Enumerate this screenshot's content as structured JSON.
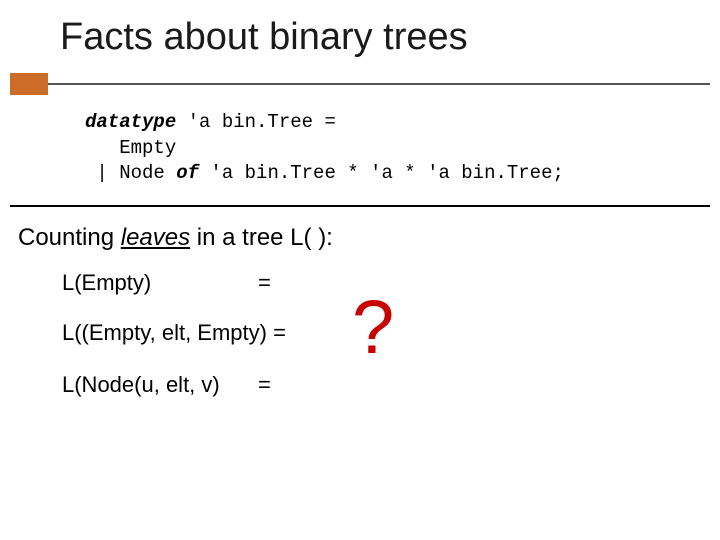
{
  "title": "Facts about binary trees",
  "code": {
    "kw_datatype": "datatype",
    "line1_rest": " 'a bin.Tree =",
    "line2": "   Empty",
    "line3_pre": " | Node ",
    "kw_of": "of",
    "line3_rest": " 'a bin.Tree * 'a * 'a bin.Tree;"
  },
  "subtitle": {
    "pre": "Counting ",
    "emph": "leaves",
    "post": " in a tree L( ):"
  },
  "rows": {
    "r1_lhs": "L(Empty)",
    "r1_eq": "=",
    "r2_full": "L((Empty, elt, Empty) =",
    "r3_lhs": "L(Node(u, elt, v)",
    "r3_eq": "="
  },
  "question_mark": "?"
}
